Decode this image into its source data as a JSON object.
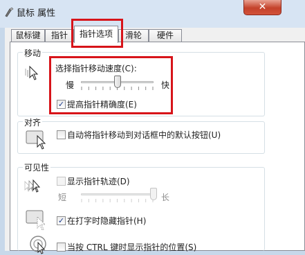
{
  "window": {
    "title": "鼠标 属性",
    "close": "✕"
  },
  "tabs": [
    "鼠标键",
    "指针",
    "指针选项",
    "滑轮",
    "硬件"
  ],
  "motion": {
    "group_title": "移动",
    "speed_label": "选择指针移动速度(C):",
    "slow": "慢",
    "fast": "快",
    "speed_level": 0.5,
    "precision_label": "提高指针精确度(E)",
    "precision_checked": true
  },
  "snap": {
    "group_title": "对齐",
    "label": "自动将指针移动到对话框中的默认按钮(U)",
    "checked": false
  },
  "visibility": {
    "group_title": "可见性",
    "trails_label": "显示指针轨迹(D)",
    "trails_checked": false,
    "short": "短",
    "long": "长",
    "trails_level": 1.0,
    "hide_label": "在打字时隐藏指针(H)",
    "hide_checked": true,
    "ctrl_label": "当按 CTRL 键时显示指针的位置(S)",
    "ctrl_checked": false
  },
  "colors": {
    "highlight": "#d7141a",
    "check": "#1b3b8c"
  }
}
